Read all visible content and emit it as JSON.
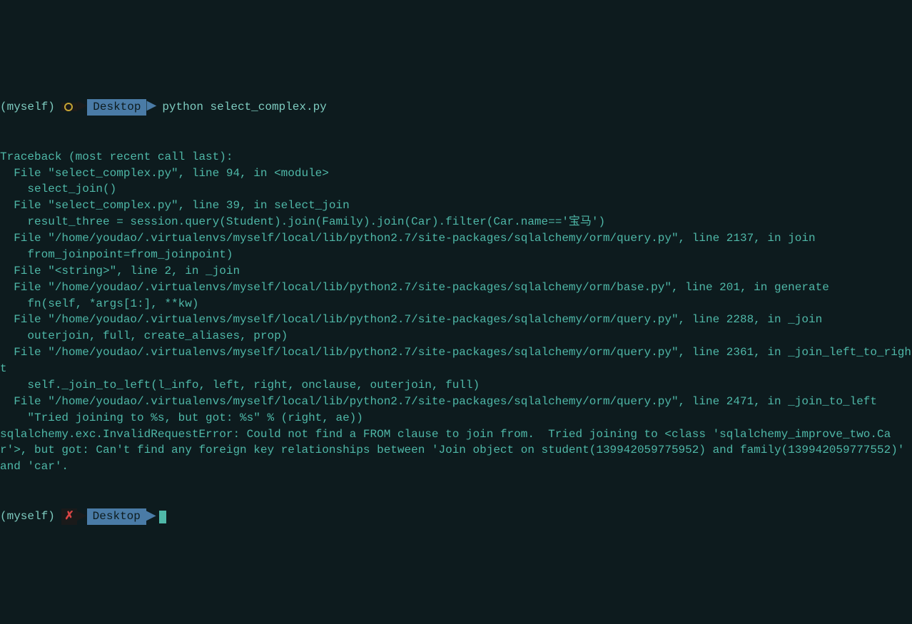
{
  "prompt1": {
    "env": "(myself)",
    "git_symbol": "○",
    "dir": "Desktop",
    "command": "python select_complex.py"
  },
  "traceback": {
    "header": "Traceback (most recent call last):",
    "lines": [
      "  File \"select_complex.py\", line 94, in <module>",
      "    select_join()",
      "  File \"select_complex.py\", line 39, in select_join",
      "    result_three = session.query(Student).join(Family).join(Car).filter(Car.name=='宝马')",
      "  File \"/home/youdao/.virtualenvs/myself/local/lib/python2.7/site-packages/sqlalchemy/orm/query.py\", line 2137, in join",
      "    from_joinpoint=from_joinpoint)",
      "  File \"<string>\", line 2, in _join",
      "  File \"/home/youdao/.virtualenvs/myself/local/lib/python2.7/site-packages/sqlalchemy/orm/base.py\", line 201, in generate",
      "    fn(self, *args[1:], **kw)",
      "  File \"/home/youdao/.virtualenvs/myself/local/lib/python2.7/site-packages/sqlalchemy/orm/query.py\", line 2288, in _join",
      "    outerjoin, full, create_aliases, prop)",
      "  File \"/home/youdao/.virtualenvs/myself/local/lib/python2.7/site-packages/sqlalchemy/orm/query.py\", line 2361, in _join_left_to_right",
      "    self._join_to_left(l_info, left, right, onclause, outerjoin, full)",
      "  File \"/home/youdao/.virtualenvs/myself/local/lib/python2.7/site-packages/sqlalchemy/orm/query.py\", line 2471, in _join_to_left",
      "    \"Tried joining to %s, but got: %s\" % (right, ae))",
      "sqlalchemy.exc.InvalidRequestError: Could not find a FROM clause to join from.  Tried joining to <class 'sqlalchemy_improve_two.Car'>, but got: Can't find any foreign key relationships between 'Join object on student(139942059775952) and family(139942059777552)' and 'car'."
    ]
  },
  "prompt2": {
    "env": "(myself)",
    "git_symbol": "✗",
    "dir": "Desktop"
  }
}
